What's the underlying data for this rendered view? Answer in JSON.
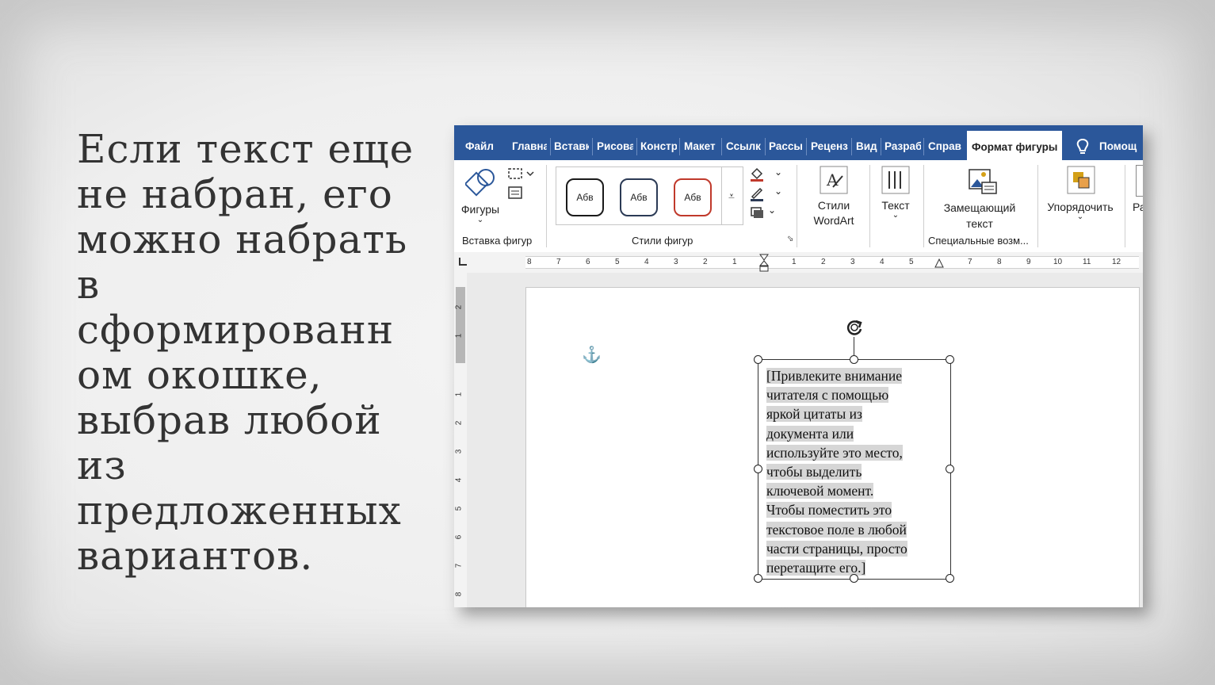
{
  "slide": {
    "text": "Если текст еще не набран, его можно набрать в сформированн ом окошке, выбрав любой из предложенных вариантов.",
    "lines": [
      "Если текст еще",
      "не набран, его",
      "можно набрать",
      "в",
      "сформированн",
      "ом окошке,",
      "выбрав любой",
      "из",
      "предложенных",
      "вариантов."
    ]
  },
  "word": {
    "tabs": [
      "Файл",
      "Главна",
      "Вставк",
      "Рисова",
      "Констр",
      "Макет",
      "Ссылк",
      "Рассы",
      "Реценз",
      "Вид",
      "Разраб",
      "Справ"
    ],
    "active_tab": "Формат фигуры",
    "help_label": "Помощ",
    "ribbon": {
      "insert_shapes": {
        "shapes_label": "Фигуры",
        "group_label": "Вставка фигур"
      },
      "shape_styles": {
        "swatches": [
          "Абв",
          "Абв",
          "Абв"
        ],
        "group_label": "Стили фигур"
      },
      "wordart_label_1": "Стили",
      "wordart_label_2": "WordArt",
      "text_label": "Текст",
      "alt_text_label_1": "Замещающий",
      "alt_text_label_2": "текст",
      "accessibility_group": "Специальные возм...",
      "arrange_label": "Упорядочить",
      "size_label": "Ра"
    },
    "ruler": {
      "numbers": [
        "8",
        "7",
        "6",
        "5",
        "4",
        "3",
        "2",
        "1",
        "1",
        "2",
        "3",
        "4",
        "5",
        "7",
        "8",
        "9",
        "10",
        "11",
        "12"
      ],
      "vertical_numbers": [
        "2",
        "1",
        "1",
        "2",
        "3",
        "4",
        "5",
        "6",
        "7",
        "8"
      ]
    },
    "textbox": {
      "lines": [
        "[Привлеките внимание",
        "читателя с помощью",
        "яркой цитаты из",
        "документа или",
        "используйте это место,",
        "чтобы выделить",
        "ключевой момент.",
        "Чтобы поместить это",
        "текстовое поле в любой",
        "части страницы, просто",
        "перетащите его.]"
      ]
    },
    "colors": {
      "ribbon_blue": "#2b579a",
      "accent_red": "#c0392b"
    }
  }
}
